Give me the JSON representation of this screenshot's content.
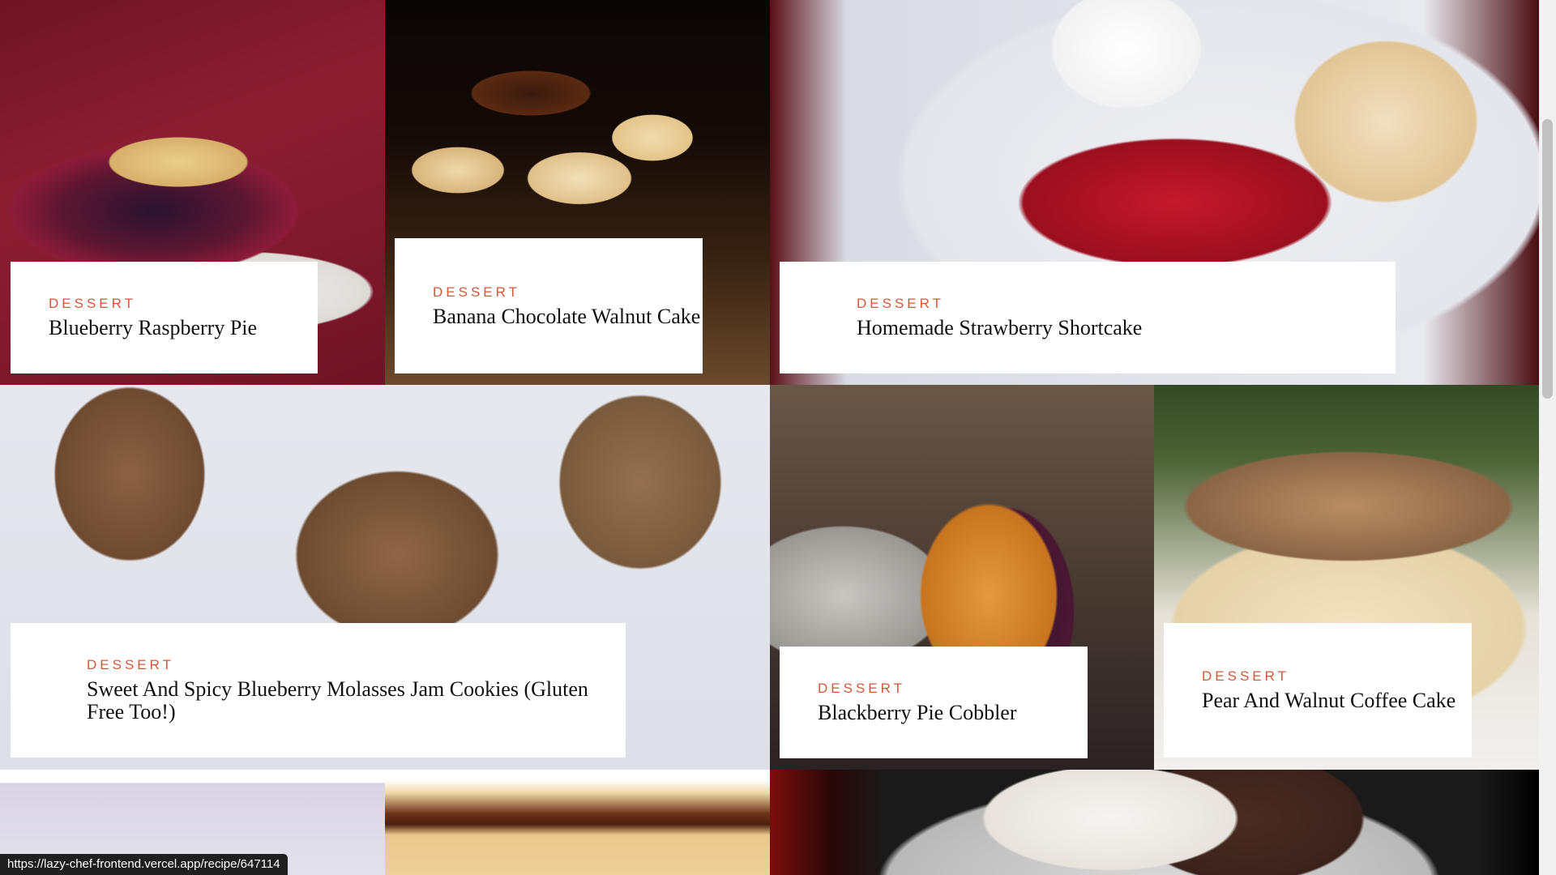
{
  "theme": {
    "category_color": "#d3583a",
    "title_color": "#111111",
    "card_background": "#ffffff"
  },
  "recipes": [
    {
      "category": "DESSERT",
      "title": "Blueberry Raspberry Pie"
    },
    {
      "category": "DESSERT",
      "title": "Banana Chocolate Walnut Cake"
    },
    {
      "category": "DESSERT",
      "title": "Homemade Strawberry Shortcake"
    },
    {
      "category": "DESSERT",
      "title": "Sweet And Spicy Blueberry Molasses Jam Cookies (Gluten Free Too!)"
    },
    {
      "category": "DESSERT",
      "title": "Blackberry Pie Cobbler"
    },
    {
      "category": "DESSERT",
      "title": "Pear And Walnut Coffee Cake"
    }
  ],
  "status_bar": {
    "url": "https://lazy-chef-frontend.vercel.app/recipe/647114"
  },
  "scrollbar": {
    "position_fraction": 0.2
  }
}
